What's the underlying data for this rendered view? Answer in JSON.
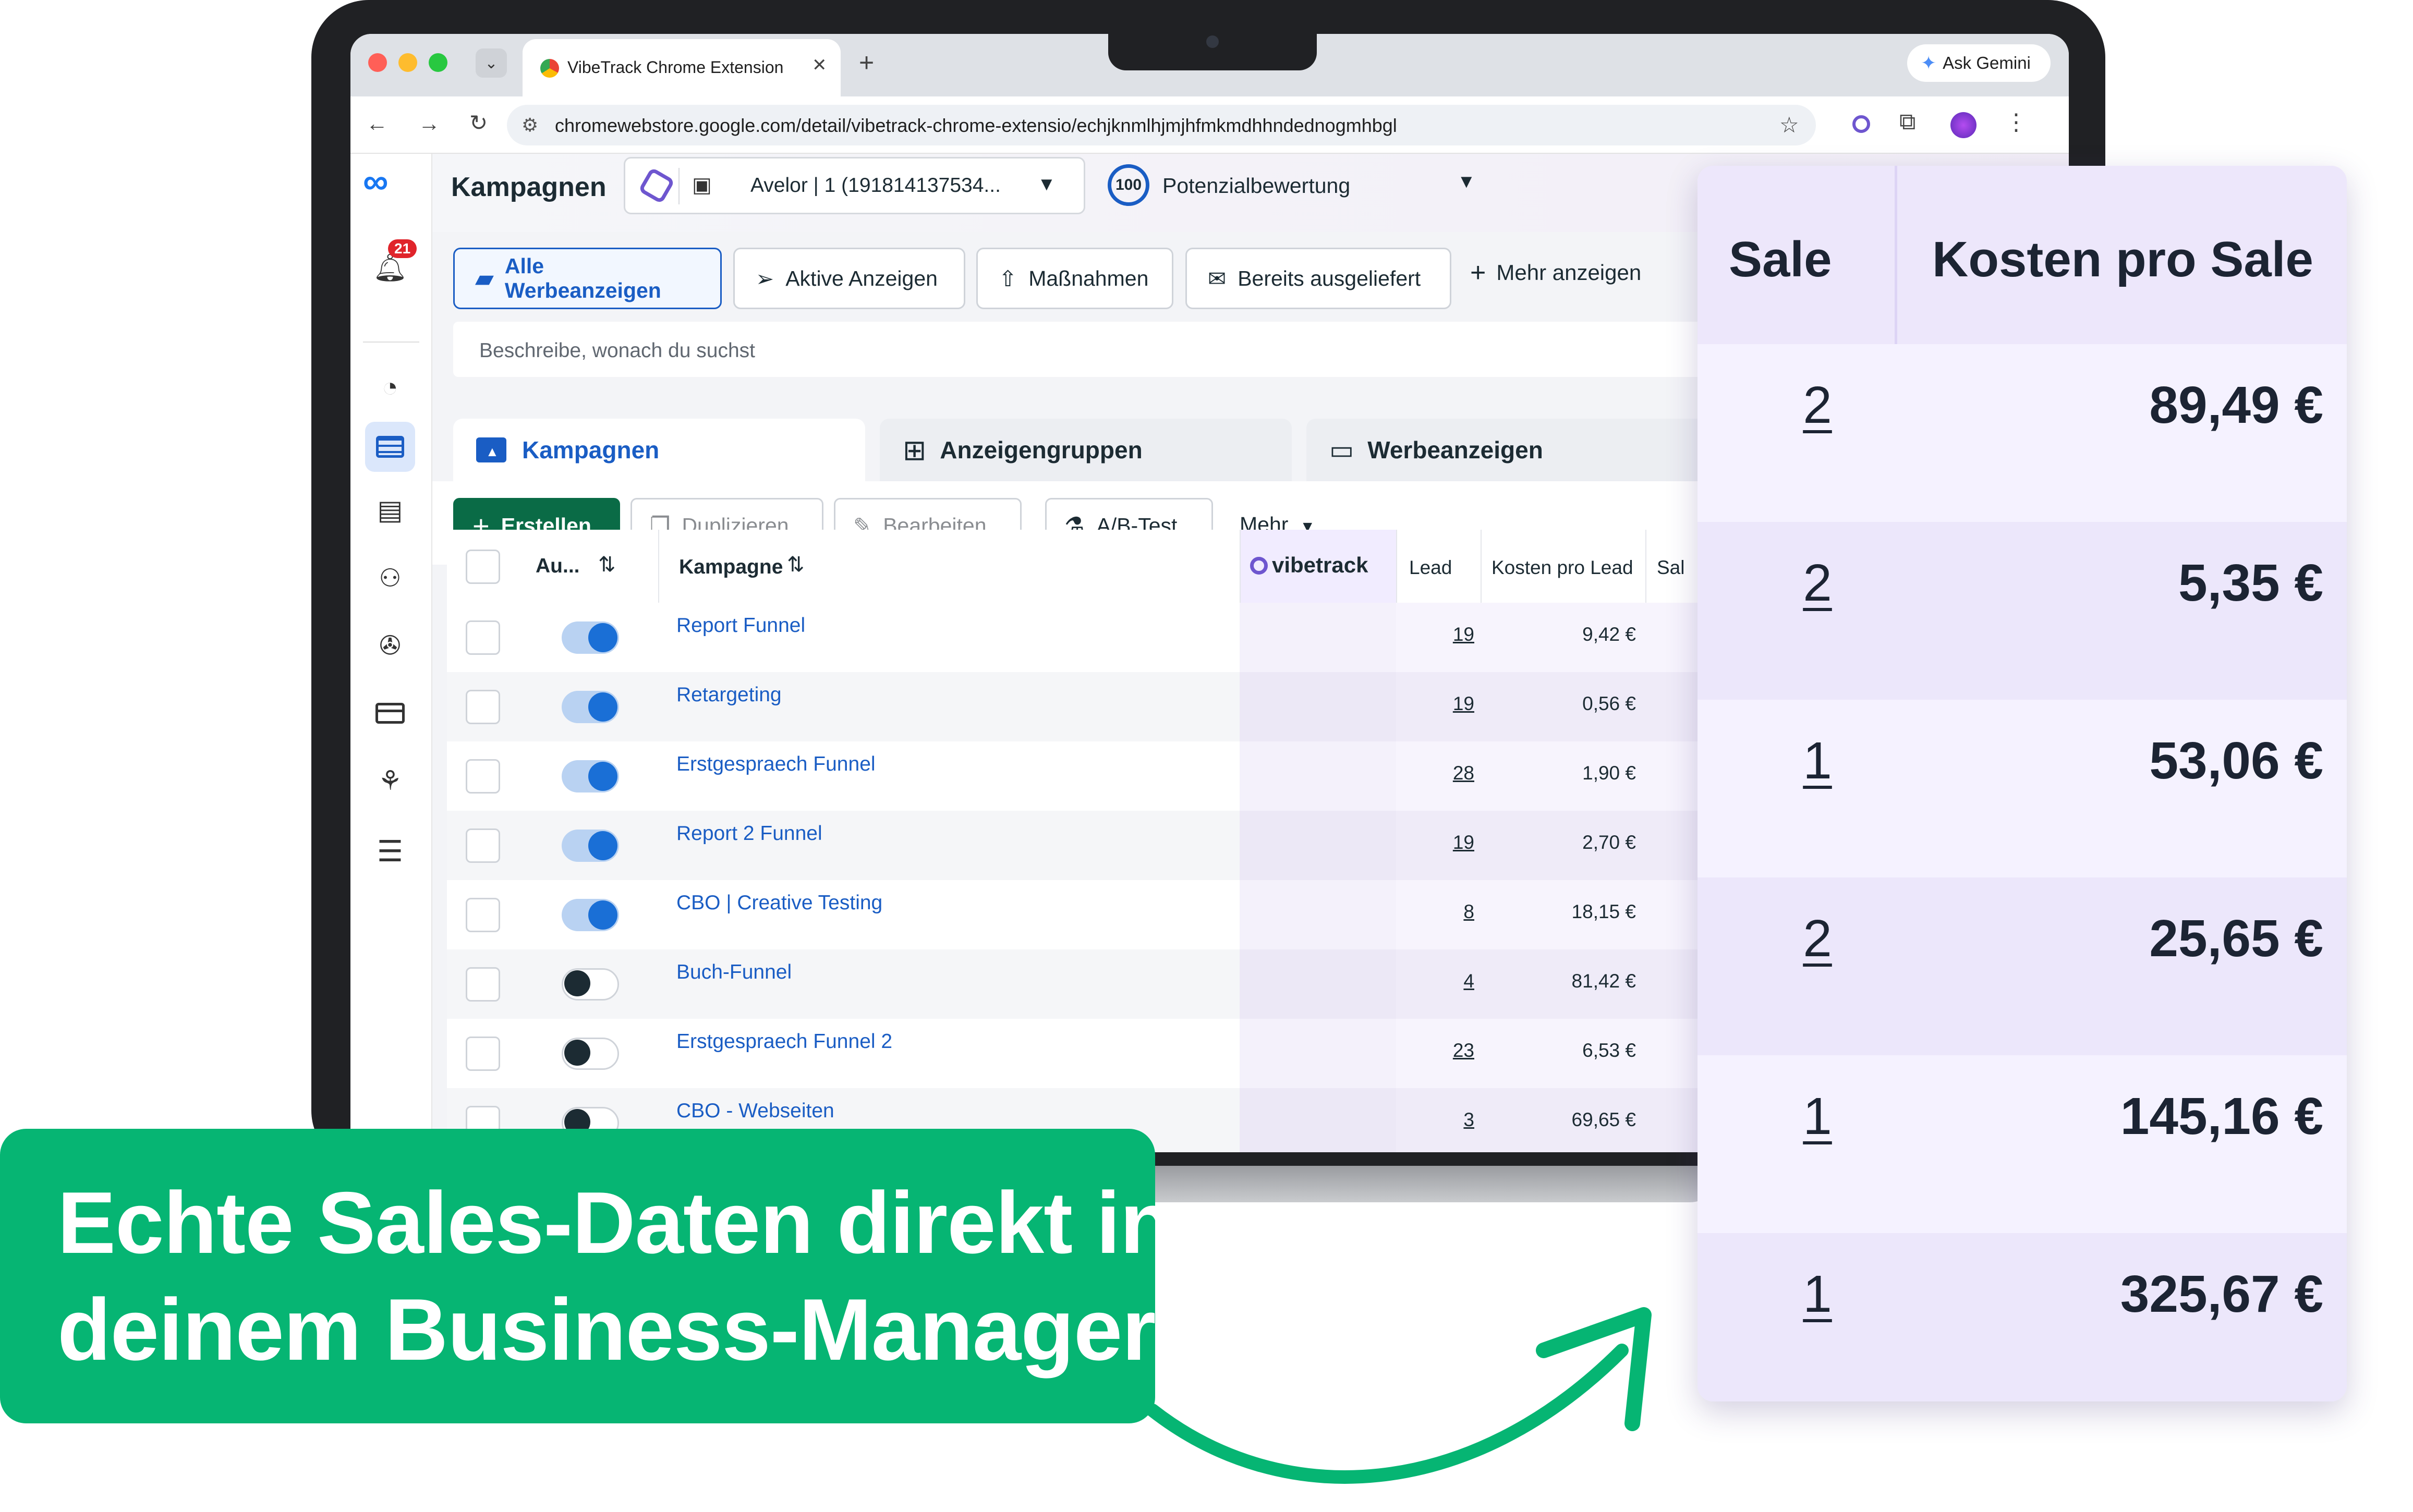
{
  "browser": {
    "tab_title": "VibeTrack Chrome Extension",
    "new_tab": "+",
    "url": "chromewebstore.google.com/detail/vibetrack-chrome-extensio/echjknmlhjmjhfmkmdhhndednogmhbgl",
    "ask_gemini": "Ask Gemini"
  },
  "app": {
    "notification_count": "21",
    "page_title": "Kampagnen",
    "account_selector": "Avelor | 1 (191814137534...",
    "score_value": "100",
    "score_label": "Potenzialbewertung",
    "filters": {
      "all_ads": "Alle Werbeanzeigen",
      "active_ads": "Aktive Anzeigen",
      "measures": "Maßnahmen",
      "delivered": "Bereits ausgeliefert",
      "more": "Mehr anzeigen"
    },
    "search_placeholder": "Beschreibe, wonach du suchst",
    "level_tabs": {
      "campaigns": "Kampagnen",
      "adsets": "Anzeigengruppen",
      "ads": "Werbeanzeigen"
    },
    "actions": {
      "create": "Erstellen",
      "duplicate": "Duplizieren",
      "edit": "Bearbeiten",
      "abtest": "A/B-Test",
      "more": "Mehr"
    },
    "table": {
      "headers": {
        "status": "Au...",
        "campaign": "Kampagne",
        "vibetrack": "vibetrack",
        "lead": "Lead",
        "cost_per_lead": "Kosten pro Lead",
        "sale_partial": "Sal"
      },
      "rows": [
        {
          "name": "Report Funnel",
          "lead": "19",
          "cpl": "9,42 €",
          "active": true
        },
        {
          "name": "Retargeting",
          "lead": "19",
          "cpl": "0,56 €",
          "active": true
        },
        {
          "name": "Erstgespraech Funnel",
          "lead": "28",
          "cpl": "1,90 €",
          "active": true
        },
        {
          "name": "Report 2 Funnel",
          "lead": "19",
          "cpl": "2,70 €",
          "active": true
        },
        {
          "name": "CBO | Creative Testing",
          "lead": "8",
          "cpl": "18,15 €",
          "active": true
        },
        {
          "name": "Buch-Funnel",
          "lead": "4",
          "cpl": "81,42 €",
          "active": false
        },
        {
          "name": "Erstgespraech Funnel 2",
          "lead": "23",
          "cpl": "6,53 €",
          "active": false
        },
        {
          "name": "CBO - Webseiten",
          "lead": "3",
          "cpl": "69,65 €",
          "active": false
        }
      ]
    }
  },
  "overlay": {
    "header_sale": "Sale",
    "header_cost": "Kosten pro Sale",
    "rows": [
      {
        "sale": "2",
        "cost": "89,49 €"
      },
      {
        "sale": "2",
        "cost": "5,35 €"
      },
      {
        "sale": "1",
        "cost": "53,06 €"
      },
      {
        "sale": "2",
        "cost": "25,65 €"
      },
      {
        "sale": "1",
        "cost": "145,16 €"
      },
      {
        "sale": "1",
        "cost": "325,67 €"
      }
    ]
  },
  "banner": {
    "line1": "Echte Sales-Daten direkt in",
    "line2": "deinem Business-Manager"
  },
  "colors": {
    "brand_green": "#06b573",
    "fb_blue": "#1877f2",
    "link_blue": "#1a5dc4",
    "create_green": "#0a6b46",
    "vibetrack_purple": "#6e56cf"
  }
}
